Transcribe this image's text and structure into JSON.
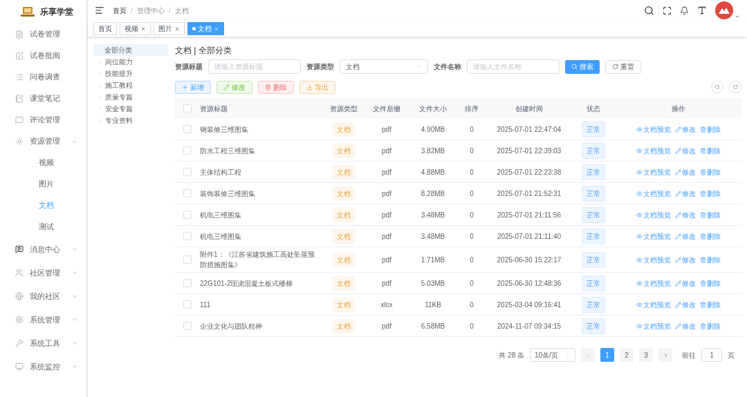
{
  "app": {
    "name": "乐享学堂"
  },
  "breadcrumb": [
    {
      "label": "首页"
    },
    {
      "separator": "/",
      "label": "管理中心"
    },
    {
      "separator": "/",
      "label": "文档"
    }
  ],
  "tags": [
    {
      "label": "首页",
      "selected": false
    },
    {
      "label": "视频",
      "selected": false
    },
    {
      "label": "图片",
      "selected": false
    },
    {
      "label": "文档",
      "selected": true
    }
  ],
  "sidebar": {
    "items": [
      {
        "label": "试卷管理"
      },
      {
        "label": "试卷批阅"
      },
      {
        "label": "问卷调查"
      },
      {
        "label": "课堂笔记"
      },
      {
        "label": "评论管理"
      },
      {
        "label": "资源管理",
        "expanded": true,
        "children": [
          {
            "label": "视频",
            "selected": false
          },
          {
            "label": "图片",
            "selected": false
          },
          {
            "label": "文档",
            "selected": true
          },
          {
            "label": "测试",
            "selected": false
          }
        ]
      },
      {
        "label": "消息中心",
        "expanded": false
      },
      {
        "label": "社区管理",
        "expanded": false
      },
      {
        "label": "我的社区",
        "expanded": false
      },
      {
        "label": "系统管理",
        "expanded": false
      },
      {
        "label": "系统工具",
        "expanded": false
      },
      {
        "label": "系统监控",
        "expanded": false
      }
    ]
  },
  "category_tree": [
    {
      "label": "全部分类",
      "selected": true
    },
    {
      "label": "岗位能力",
      "selected": false,
      "expanded": false
    },
    {
      "label": "技能提升",
      "selected": false,
      "expanded": false
    },
    {
      "label": "施工教程",
      "selected": false,
      "expanded": false
    },
    {
      "label": "质量专篇",
      "selected": false,
      "expanded": false
    },
    {
      "label": "安全专篇",
      "selected": false,
      "expanded": false
    },
    {
      "label": "专业资料",
      "selected": false,
      "expanded": false
    }
  ],
  "page_title": "文档 | 全部分类",
  "filters": [
    {
      "label": "资源标题",
      "kind": "input",
      "placeholder": "请输入资源标题"
    },
    {
      "label": "资源类型",
      "kind": "select",
      "value": "文档"
    },
    {
      "label": "文件名称",
      "kind": "input",
      "placeholder": "请输入文件名称"
    }
  ],
  "search_button": "搜索",
  "reset_button": "重置",
  "toolbar": [
    {
      "label": "新增",
      "kind": "add"
    },
    {
      "label": "修改",
      "kind": "edit"
    },
    {
      "label": "删除",
      "kind": "delete"
    },
    {
      "label": "导出",
      "kind": "export"
    }
  ],
  "table": {
    "select_all_checked": false,
    "columns": [
      "资源标题",
      "资源类型",
      "文件后缀",
      "文件大小",
      "排序",
      "创建时间",
      "状态",
      "操作"
    ],
    "rows": [
      {
        "checked": false,
        "title": "钢装修三维图集",
        "type": "文档",
        "ext": "pdf",
        "size": "4.90MB",
        "order": "0",
        "created": "2025-07-01 22:47:04",
        "status": "正常",
        "actions": [
          "文档预览",
          "修改",
          "删除"
        ]
      },
      {
        "checked": false,
        "title": "防水工程三维图集",
        "type": "文档",
        "ext": "pdf",
        "size": "3.82MB",
        "order": "0",
        "created": "2025-07-01 22:39:03",
        "status": "正常",
        "actions": [
          "文档预览",
          "修改",
          "删除"
        ]
      },
      {
        "checked": false,
        "title": "主体结构工程",
        "type": "文档",
        "ext": "pdf",
        "size": "4.88MB",
        "order": "0",
        "created": "2025-07-01 22:23:38",
        "status": "正常",
        "actions": [
          "文档预览",
          "修改",
          "删除"
        ]
      },
      {
        "checked": false,
        "title": "装饰装修三维图集",
        "type": "文档",
        "ext": "pdf",
        "size": "8.28MB",
        "order": "0",
        "created": "2025-07-01 21:52:31",
        "status": "正常",
        "actions": [
          "文档预览",
          "修改",
          "删除"
        ]
      },
      {
        "checked": false,
        "title": "机电三维图集",
        "type": "文档",
        "ext": "pdf",
        "size": "3.48MB",
        "order": "0",
        "created": "2025-07-01 21:11:56",
        "status": "正常",
        "actions": [
          "文档预览",
          "修改",
          "删除"
        ]
      },
      {
        "checked": false,
        "title": "机电三维图集",
        "type": "文档",
        "ext": "pdf",
        "size": "3.48MB",
        "order": "0",
        "created": "2025-07-01 21:11:40",
        "status": "正常",
        "actions": [
          "文档预览",
          "修改",
          "删除"
        ]
      },
      {
        "checked": false,
        "title": "附件1：《江苏省建筑施工高处坠落预防措施图集》",
        "type": "文档",
        "ext": "pdf",
        "size": "1.71MB",
        "order": "0",
        "created": "2025-06-30 15:22:17",
        "status": "正常",
        "actions": [
          "文档预览",
          "修改",
          "删除"
        ]
      },
      {
        "checked": false,
        "title": "22G101-2现浇混凝土板式楼梯",
        "type": "文档",
        "ext": "pdf",
        "size": "5.03MB",
        "order": "0",
        "created": "2025-06-30 12:48:36",
        "status": "正常",
        "actions": [
          "文档预览",
          "修改",
          "删除"
        ]
      },
      {
        "checked": false,
        "title": "111",
        "type": "文档",
        "ext": "xlsx",
        "size": "11KB",
        "order": "0",
        "created": "2025-03-04 09:16:41",
        "status": "正常",
        "actions": [
          "文档预览",
          "修改",
          "删除"
        ]
      },
      {
        "checked": false,
        "title": "企业文化与团队精神",
        "type": "文档",
        "ext": "pdf",
        "size": "6.58MB",
        "order": "0",
        "created": "2024-11-07 09:34:15",
        "status": "正常",
        "actions": [
          "文档预览",
          "修改",
          "删除"
        ]
      }
    ]
  },
  "pagination": {
    "total": "共 28 条",
    "page_size": "10条/页",
    "pages": [
      {
        "label": "1",
        "selected": true
      },
      {
        "label": "2",
        "selected": false
      },
      {
        "label": "3",
        "selected": false
      }
    ],
    "goto_label": "前往",
    "goto_value": "1",
    "goto_suffix": "页"
  }
}
